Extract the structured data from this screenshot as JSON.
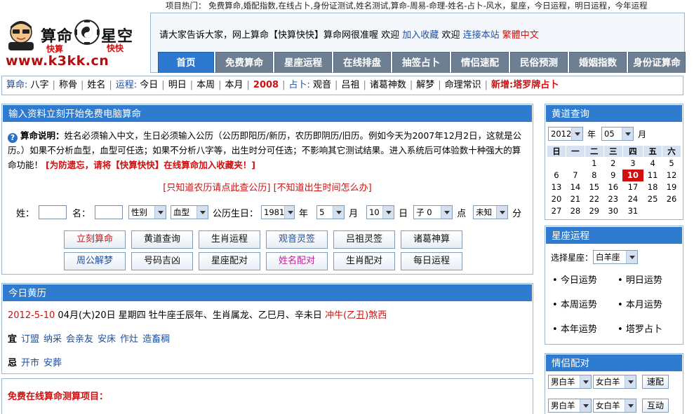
{
  "hotline": {
    "prefix": "项目热门：",
    "items": "免费算命,婚配指数,在线占卜,身份证测试,姓名测试,算命-周易-命理-姓名-占卜-风水，星座，今日运程，明日运程，今年运程"
  },
  "logo": {
    "title_left": "算命",
    "title_right": "星空",
    "slogan_left": "快算",
    "slogan_right": "快快",
    "url": "www.k3kk.cn"
  },
  "announce": {
    "text": "请大家告诉大家，网上算命【快算快快】算命网很准喔 欢迎",
    "bookmark": "加入收藏",
    "welcome2": "欢迎",
    "link_us": "连接本站",
    "traditional": "繁體中文"
  },
  "nav": {
    "tabs": [
      {
        "label": "首页",
        "w": 80
      },
      {
        "label": "免费算命",
        "w": 82
      },
      {
        "label": "星座运程",
        "w": 82
      },
      {
        "label": "在线排盘",
        "w": 82
      },
      {
        "label": "抽签占卜",
        "w": 82
      },
      {
        "label": "情侣速配",
        "w": 82
      },
      {
        "label": "民俗预测",
        "w": 82
      },
      {
        "label": "婚姻指数",
        "w": 82
      },
      {
        "label": "身份证算命",
        "w": 82
      }
    ]
  },
  "subnav": {
    "g1": "算命:",
    "g1_items": [
      "八字",
      "称骨",
      "姓名"
    ],
    "g2": "运程:",
    "g2_items": [
      "今日",
      "明日",
      "本周",
      "本月"
    ],
    "g2_hl": "2008",
    "g3": "占卜:",
    "g3_items": [
      "观音",
      "吕祖",
      "诸葛神数",
      "解梦",
      "命理常识"
    ],
    "new": "新增:塔罗牌占卜"
  },
  "main": {
    "title": "输入资料立刻开始免费电脑算命",
    "desc_label": "算命说明：",
    "desc_text": "姓名必须输入中文，生日必须输入公历（公历即阳历/新历，农历即阴历/旧历。例如今天为2007年12月2日，这就是公历。）如果不分析血型，血型可任选；如果不分析八字等，出生时分可任选；不影响其它测试结果。进入系统后可体验数十种强大的算命功能！",
    "desc_red": "[为防遗忘，请将【快算快快】在线算命加入收藏夹！]",
    "link_lunar": "[只知道农历请点此查公历]",
    "link_time": "[不知道出生时间怎么办]",
    "form": {
      "surname_label": "姓：",
      "name_label": "名：",
      "gender": "性别",
      "blood": "血型",
      "birthday_label": "公历生日：",
      "year": "1981",
      "year_unit": "年",
      "month": "5",
      "month_unit": "月",
      "day": "10",
      "day_unit": "日",
      "hour": "子 0",
      "hour_unit": "点",
      "minute": "未知",
      "minute_unit": "分"
    },
    "buttons": [
      {
        "label": "立刻算命",
        "color": "#d01010"
      },
      {
        "label": "黄道查询",
        "color": "#111111"
      },
      {
        "label": "生肖运程",
        "color": "#111111"
      },
      {
        "label": "观音灵签",
        "color": "#1f4fa0"
      },
      {
        "label": "吕祖灵签",
        "color": "#111111"
      },
      {
        "label": "诸葛神算",
        "color": "#111111"
      },
      {
        "label": "周公解梦",
        "color": "#1f4fa0"
      },
      {
        "label": "号码吉凶",
        "color": "#111111"
      },
      {
        "label": "星座配对",
        "color": "#111111"
      },
      {
        "label": "姓名配对",
        "color": "#c0209a"
      },
      {
        "label": "生肖配对",
        "color": "#111111"
      },
      {
        "label": "每日运程",
        "color": "#111111"
      }
    ]
  },
  "today": {
    "title": "今日黄历",
    "date": "2012-5-10",
    "info": "04月(大)20日 星期四 牡牛座壬辰年、生肖属龙、乙巳月、辛未日",
    "clash": "冲牛(乙丑)煞西",
    "yi_label": "宜",
    "yi": [
      "订盟",
      "纳采",
      "会亲友",
      "安床",
      "作灶",
      "造畜稠"
    ],
    "ji_label": "忌",
    "ji": [
      "开市",
      "安葬"
    ]
  },
  "free": {
    "title": "免费在线算命测算项目："
  },
  "calendar": {
    "title": "黄道查询",
    "year": "2012",
    "year_unit": "年",
    "month": "05",
    "month_unit": "月",
    "weekdays": [
      "日",
      "一",
      "二",
      "三",
      "四",
      "五",
      "六"
    ],
    "weeks": [
      [
        "",
        "",
        "1",
        "2",
        "3",
        "4",
        "5"
      ],
      [
        "6",
        "7",
        "8",
        "9",
        "10",
        "11",
        "12"
      ],
      [
        "13",
        "14",
        "15",
        "16",
        "17",
        "18",
        "19"
      ],
      [
        "20",
        "21",
        "22",
        "23",
        "24",
        "25",
        "26"
      ],
      [
        "27",
        "28",
        "29",
        "30",
        "31",
        "",
        ""
      ]
    ],
    "today": "10"
  },
  "star": {
    "title": "星座运程",
    "select_label": "选择星座：",
    "selected": "白羊座",
    "links": [
      "今日运势",
      "明日运势",
      "本周运势",
      "本月运势",
      "本年运势",
      "塔罗占卜"
    ]
  },
  "love": {
    "title": "情侣配对",
    "rows": [
      {
        "a": "男白羊",
        "b": "女白羊",
        "btn": "速配"
      },
      {
        "a": "男白羊",
        "b": "女白羊",
        "btn": "互动"
      }
    ]
  },
  "colors": {
    "header_blue": "#2f7bd0",
    "tab_gray": "#6e7f93",
    "accent_red": "#d01010",
    "link_blue": "#1f4fa0"
  }
}
